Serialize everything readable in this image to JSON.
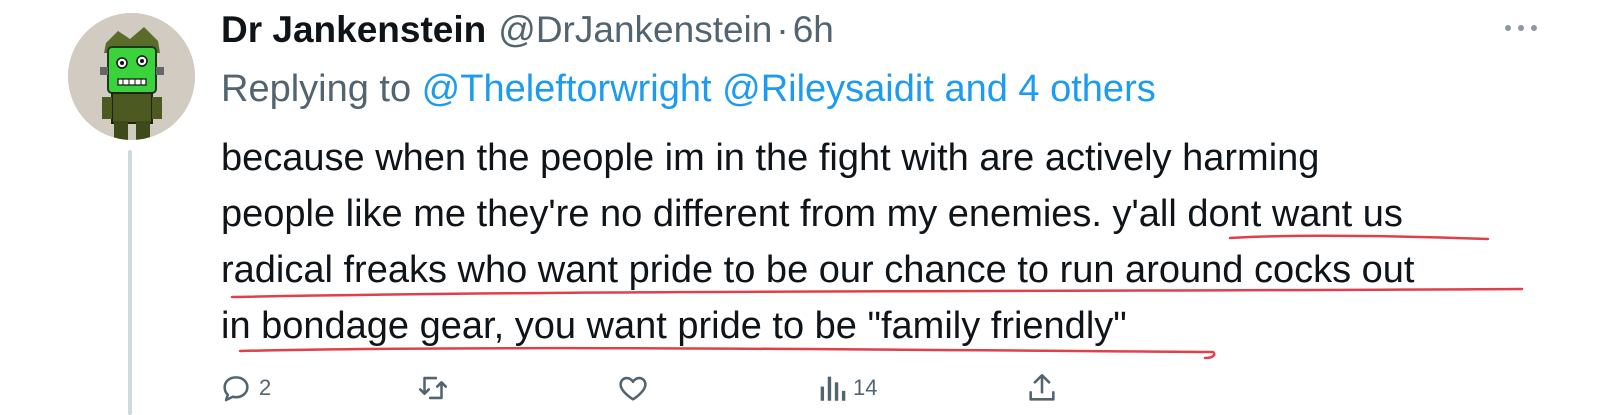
{
  "tweet": {
    "author_name": "Dr Jankenstein",
    "handle": "@DrJankenstein",
    "separator": "·",
    "time": "6h",
    "reply_prefix": "Replying to ",
    "mention_1": "@Theleftorwright",
    "mention_2": "@Rileysaidit",
    "and_others": "and 4 others",
    "text_lines": [
      "because when the people im in the fight with are actively harming",
      "people like me they're no different from my enemies. y'all dont want us",
      "radical freaks who want pride to be our chance to run around cocks out",
      "in bondage gear, you want pride to be \"family friendly\""
    ]
  },
  "actions": {
    "reply_count": "2",
    "retweet_count": "",
    "like_count": "",
    "views_count": "14"
  },
  "colors": {
    "text": "#0f1419",
    "secondary": "#536471",
    "link": "#1d9bf0",
    "annotation_underline": "#e0404a",
    "thread_line": "#cfd9de"
  },
  "icons": [
    "more-icon",
    "reply-icon",
    "retweet-icon",
    "like-icon",
    "views-icon",
    "share-icon"
  ]
}
